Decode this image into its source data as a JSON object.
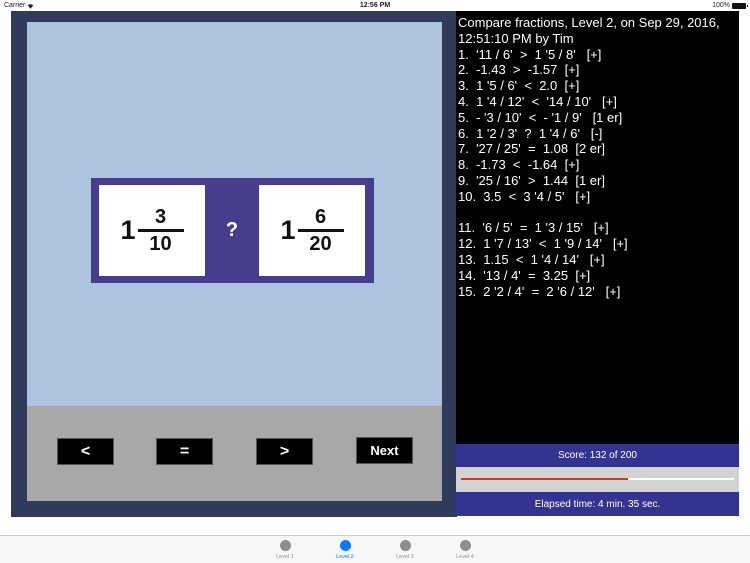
{
  "status_bar": {
    "carrier": "Carrier",
    "wifi_icon": "wifi-icon",
    "time": "12:56 PM",
    "battery_percent": "100%",
    "battery_icon": "battery-icon"
  },
  "problem": {
    "left": {
      "whole": "1",
      "numerator": "3",
      "denominator": "10"
    },
    "operator": "?",
    "right": {
      "whole": "1",
      "numerator": "6",
      "denominator": "20"
    }
  },
  "buttons": {
    "less": "<",
    "equal": "=",
    "greater": ">",
    "next": "Next"
  },
  "history": {
    "title": "Compare fractions, Level 2, on Sep 29, 2016, 12:51:10 PM by Tim",
    "entries": [
      "1.  '11 / 6'  >  1 '5 / 8'   [+]",
      "2.  -1.43  >  -1.57  [+]",
      "3.  1 '5 / 6'  <  2.0  [+]",
      "4.  1 '4 / 12'  <  '14 / 10'   [+]",
      "5.  - '3 / 10'  <  - '1 / 9'   [1 er]",
      "6.  1 '2 / 3'  ?  1 '4 / 6'   [-]",
      "7.  '27 / 25'  =  1.08  [2 er]",
      "8.  -1.73  <  -1.64  [+]",
      "9.  '25 / 16'  >  1.44  [1 er]",
      "10.  3.5  <  3 '4 / 5'   [+]",
      "",
      "11.  '6 / 5'  =  1 '3 / 15'   [+]",
      "12.  1 '7 / 13'  <  1 '9 / 14'   [+]",
      "13.  1.15  <  1 '4 / 14'   [+]",
      "14.  '13 / 4'  =  3.25  [+]",
      "15.  2 '2 / 4'  =  2 '6 / 12'   [+]"
    ]
  },
  "score": {
    "label": "Score: 132 of 200",
    "value": 132,
    "max": 200
  },
  "progress": {
    "fraction": 0.61,
    "fill_color": "#e03020"
  },
  "elapsed": {
    "label": "Elapsed time: 4 min.  35 sec."
  },
  "tabs": [
    {
      "label": "Level 1",
      "active": false
    },
    {
      "label": "Level 2",
      "active": true
    },
    {
      "label": "Level 3",
      "active": false
    },
    {
      "label": "Level 4",
      "active": false
    }
  ],
  "colors": {
    "frame": "#303a5a",
    "question_bg": "#aec3df",
    "problem_box": "#463d8d",
    "button_area": "#a8a8a8",
    "score_bar": "#323490",
    "tab_active": "#0a7aff"
  }
}
